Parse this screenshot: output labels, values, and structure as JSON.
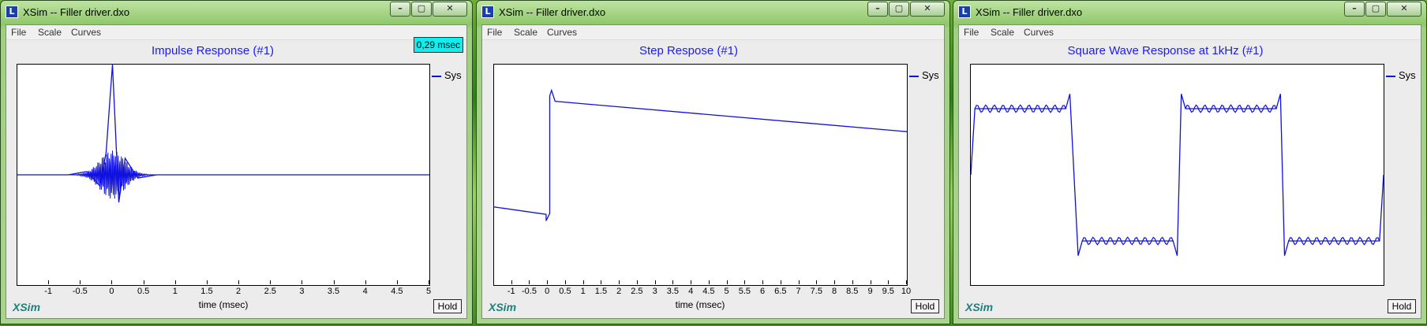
{
  "colors": {
    "curve": "#1010e0",
    "title": "#1a1aff",
    "readout_bg": "#0ef0f0",
    "brand": "#1e7f7a"
  },
  "icons": {
    "app": "xsim-app-icon",
    "minimize": "minimize-icon",
    "maximize": "maximize-icon",
    "close": "close-icon"
  },
  "windows": [
    {
      "title": "XSim -- Filler driver.dxo",
      "app_icon_glyph": "L",
      "menu": [
        "File",
        "Scale",
        "Curves"
      ],
      "controls": {
        "minimize": "–",
        "maximize": "▢",
        "close": "✕"
      },
      "readout": "0,29 msec",
      "legend": "Sys",
      "brand": "XSim",
      "hold": "Hold",
      "chart_data": {
        "type": "line",
        "title": "Impulse Response (#1)",
        "xlabel": "time (msec)",
        "xlim": [
          -1.5,
          5
        ],
        "xticks": [
          "-1",
          "-0.5",
          "0",
          "0.5",
          "1",
          "1.5",
          "2",
          "2.5",
          "3",
          "3.5",
          "4",
          "4.5",
          "5"
        ],
        "xtick_values": [
          -1,
          -0.5,
          0,
          0.5,
          1,
          1.5,
          2,
          2.5,
          3,
          3.5,
          4,
          4.5,
          5
        ],
        "ylim": [
          -1,
          1
        ],
        "series": [
          {
            "name": "Sys",
            "x": [
              -1.5,
              -0.7,
              -0.4,
              -0.2,
              -0.1,
              0,
              0.1,
              0.2,
              0.4,
              0.7,
              5
            ],
            "y": [
              0,
              0,
              0.03,
              -0.1,
              0.2,
              1,
              -0.25,
              0.15,
              -0.03,
              0,
              0
            ]
          }
        ]
      }
    },
    {
      "title": "XSim -- Filler driver.dxo",
      "app_icon_glyph": "L",
      "menu": [
        "File",
        "Scale",
        "Curves"
      ],
      "controls": {
        "minimize": "–",
        "maximize": "▢",
        "close": "✕"
      },
      "legend": "Sys",
      "brand": "XSim",
      "hold": "Hold",
      "chart_data": {
        "type": "line",
        "title": "Step Respose (#1)",
        "xlabel": "time (msec)",
        "xlim": [
          -1.5,
          10
        ],
        "xticks": [
          "-1",
          "-0.5",
          "0",
          "0.5",
          "1",
          "1.5",
          "2",
          "2.5",
          "3",
          "3.5",
          "4",
          "4.5",
          "5",
          "5.5",
          "6",
          "6.5",
          "7",
          "7.5",
          "8",
          "8.5",
          "9",
          "9.5",
          "10"
        ],
        "xtick_values": [
          -1,
          -0.5,
          0,
          0.5,
          1,
          1.5,
          2,
          2.5,
          3,
          3.5,
          4,
          4.5,
          5,
          5.5,
          6,
          6.5,
          7,
          7.5,
          8,
          8.5,
          9,
          9.5,
          10
        ],
        "ylim": [
          -1.2,
          1.2
        ],
        "series": [
          {
            "name": "Sys",
            "x": [
              -1.5,
              -0.05,
              -0.05,
              0.05,
              0.05,
              0.1,
              0.2,
              10
            ],
            "y": [
              -0.35,
              -0.43,
              -0.5,
              -0.42,
              0.86,
              0.92,
              0.8,
              0.47
            ]
          }
        ]
      }
    },
    {
      "title": "XSim -- Filler driver.dxo",
      "app_icon_glyph": "L",
      "menu": [
        "File",
        "Scale",
        "Curves"
      ],
      "controls": {
        "minimize": "–",
        "maximize": "▢",
        "close": "✕"
      },
      "legend": "Sys",
      "brand": "XSim",
      "hold": "Hold",
      "chart_data": {
        "type": "line",
        "title": "Square Wave Response at 1kHz (#1)",
        "xlabel": "",
        "ylim": [
          -1.2,
          1.2
        ],
        "series": [
          {
            "name": "Sys",
            "x": [
              0,
              0.01,
              0.23,
              0.24,
              0.26,
              0.27,
              0.49,
              0.5,
              0.51,
              0.52,
              0.74,
              0.75,
              0.76,
              0.77,
              0.99,
              1.0
            ],
            "y": [
              0,
              0.72,
              0.72,
              0.88,
              -0.88,
              -0.72,
              -0.72,
              -0.88,
              0.88,
              0.72,
              0.72,
              0.88,
              -0.88,
              -0.72,
              -0.72,
              0
            ]
          }
        ]
      }
    }
  ]
}
